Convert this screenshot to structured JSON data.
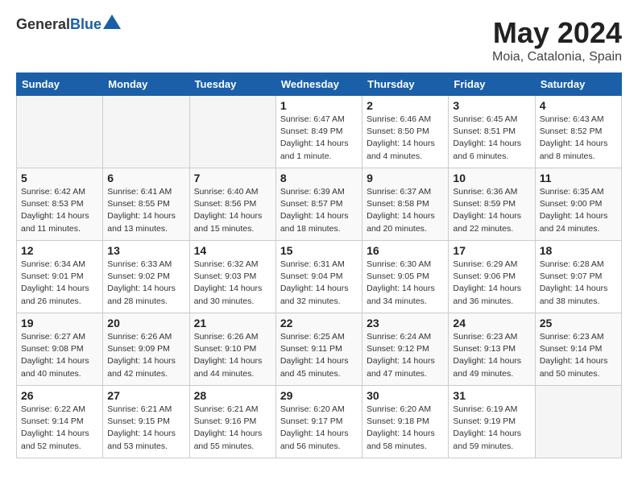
{
  "header": {
    "logo_general": "General",
    "logo_blue": "Blue",
    "month_title": "May 2024",
    "location": "Moia, Catalonia, Spain"
  },
  "days_of_week": [
    "Sunday",
    "Monday",
    "Tuesday",
    "Wednesday",
    "Thursday",
    "Friday",
    "Saturday"
  ],
  "weeks": [
    [
      {
        "day": "",
        "empty": true
      },
      {
        "day": "",
        "empty": true
      },
      {
        "day": "",
        "empty": true
      },
      {
        "day": "1",
        "sunrise": "Sunrise: 6:47 AM",
        "sunset": "Sunset: 8:49 PM",
        "daylight": "Daylight: 14 hours and 1 minute."
      },
      {
        "day": "2",
        "sunrise": "Sunrise: 6:46 AM",
        "sunset": "Sunset: 8:50 PM",
        "daylight": "Daylight: 14 hours and 4 minutes."
      },
      {
        "day": "3",
        "sunrise": "Sunrise: 6:45 AM",
        "sunset": "Sunset: 8:51 PM",
        "daylight": "Daylight: 14 hours and 6 minutes."
      },
      {
        "day": "4",
        "sunrise": "Sunrise: 6:43 AM",
        "sunset": "Sunset: 8:52 PM",
        "daylight": "Daylight: 14 hours and 8 minutes."
      }
    ],
    [
      {
        "day": "5",
        "sunrise": "Sunrise: 6:42 AM",
        "sunset": "Sunset: 8:53 PM",
        "daylight": "Daylight: 14 hours and 11 minutes."
      },
      {
        "day": "6",
        "sunrise": "Sunrise: 6:41 AM",
        "sunset": "Sunset: 8:55 PM",
        "daylight": "Daylight: 14 hours and 13 minutes."
      },
      {
        "day": "7",
        "sunrise": "Sunrise: 6:40 AM",
        "sunset": "Sunset: 8:56 PM",
        "daylight": "Daylight: 14 hours and 15 minutes."
      },
      {
        "day": "8",
        "sunrise": "Sunrise: 6:39 AM",
        "sunset": "Sunset: 8:57 PM",
        "daylight": "Daylight: 14 hours and 18 minutes."
      },
      {
        "day": "9",
        "sunrise": "Sunrise: 6:37 AM",
        "sunset": "Sunset: 8:58 PM",
        "daylight": "Daylight: 14 hours and 20 minutes."
      },
      {
        "day": "10",
        "sunrise": "Sunrise: 6:36 AM",
        "sunset": "Sunset: 8:59 PM",
        "daylight": "Daylight: 14 hours and 22 minutes."
      },
      {
        "day": "11",
        "sunrise": "Sunrise: 6:35 AM",
        "sunset": "Sunset: 9:00 PM",
        "daylight": "Daylight: 14 hours and 24 minutes."
      }
    ],
    [
      {
        "day": "12",
        "sunrise": "Sunrise: 6:34 AM",
        "sunset": "Sunset: 9:01 PM",
        "daylight": "Daylight: 14 hours and 26 minutes."
      },
      {
        "day": "13",
        "sunrise": "Sunrise: 6:33 AM",
        "sunset": "Sunset: 9:02 PM",
        "daylight": "Daylight: 14 hours and 28 minutes."
      },
      {
        "day": "14",
        "sunrise": "Sunrise: 6:32 AM",
        "sunset": "Sunset: 9:03 PM",
        "daylight": "Daylight: 14 hours and 30 minutes."
      },
      {
        "day": "15",
        "sunrise": "Sunrise: 6:31 AM",
        "sunset": "Sunset: 9:04 PM",
        "daylight": "Daylight: 14 hours and 32 minutes."
      },
      {
        "day": "16",
        "sunrise": "Sunrise: 6:30 AM",
        "sunset": "Sunset: 9:05 PM",
        "daylight": "Daylight: 14 hours and 34 minutes."
      },
      {
        "day": "17",
        "sunrise": "Sunrise: 6:29 AM",
        "sunset": "Sunset: 9:06 PM",
        "daylight": "Daylight: 14 hours and 36 minutes."
      },
      {
        "day": "18",
        "sunrise": "Sunrise: 6:28 AM",
        "sunset": "Sunset: 9:07 PM",
        "daylight": "Daylight: 14 hours and 38 minutes."
      }
    ],
    [
      {
        "day": "19",
        "sunrise": "Sunrise: 6:27 AM",
        "sunset": "Sunset: 9:08 PM",
        "daylight": "Daylight: 14 hours and 40 minutes."
      },
      {
        "day": "20",
        "sunrise": "Sunrise: 6:26 AM",
        "sunset": "Sunset: 9:09 PM",
        "daylight": "Daylight: 14 hours and 42 minutes."
      },
      {
        "day": "21",
        "sunrise": "Sunrise: 6:26 AM",
        "sunset": "Sunset: 9:10 PM",
        "daylight": "Daylight: 14 hours and 44 minutes."
      },
      {
        "day": "22",
        "sunrise": "Sunrise: 6:25 AM",
        "sunset": "Sunset: 9:11 PM",
        "daylight": "Daylight: 14 hours and 45 minutes."
      },
      {
        "day": "23",
        "sunrise": "Sunrise: 6:24 AM",
        "sunset": "Sunset: 9:12 PM",
        "daylight": "Daylight: 14 hours and 47 minutes."
      },
      {
        "day": "24",
        "sunrise": "Sunrise: 6:23 AM",
        "sunset": "Sunset: 9:13 PM",
        "daylight": "Daylight: 14 hours and 49 minutes."
      },
      {
        "day": "25",
        "sunrise": "Sunrise: 6:23 AM",
        "sunset": "Sunset: 9:14 PM",
        "daylight": "Daylight: 14 hours and 50 minutes."
      }
    ],
    [
      {
        "day": "26",
        "sunrise": "Sunrise: 6:22 AM",
        "sunset": "Sunset: 9:14 PM",
        "daylight": "Daylight: 14 hours and 52 minutes."
      },
      {
        "day": "27",
        "sunrise": "Sunrise: 6:21 AM",
        "sunset": "Sunset: 9:15 PM",
        "daylight": "Daylight: 14 hours and 53 minutes."
      },
      {
        "day": "28",
        "sunrise": "Sunrise: 6:21 AM",
        "sunset": "Sunset: 9:16 PM",
        "daylight": "Daylight: 14 hours and 55 minutes."
      },
      {
        "day": "29",
        "sunrise": "Sunrise: 6:20 AM",
        "sunset": "Sunset: 9:17 PM",
        "daylight": "Daylight: 14 hours and 56 minutes."
      },
      {
        "day": "30",
        "sunrise": "Sunrise: 6:20 AM",
        "sunset": "Sunset: 9:18 PM",
        "daylight": "Daylight: 14 hours and 58 minutes."
      },
      {
        "day": "31",
        "sunrise": "Sunrise: 6:19 AM",
        "sunset": "Sunset: 9:19 PM",
        "daylight": "Daylight: 14 hours and 59 minutes."
      },
      {
        "day": "",
        "empty": true
      }
    ]
  ]
}
